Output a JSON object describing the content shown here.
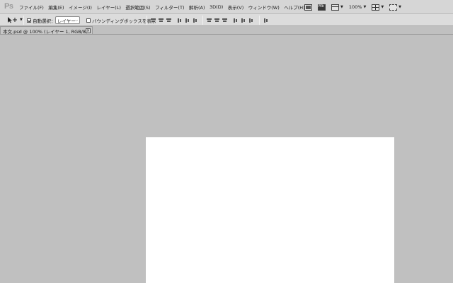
{
  "app": {
    "logo": "Ps"
  },
  "menubar": {
    "items": [
      "ファイル(F)",
      "編集(E)",
      "イメージ(I)",
      "レイヤー(L)",
      "選択範囲(S)",
      "フィルター(T)",
      "解析(A)",
      "3D(D)",
      "表示(V)",
      "ウィンドウ(W)",
      "ヘルプ(H)"
    ],
    "zoom": "100%"
  },
  "options": {
    "auto_select_label": "自動選択：",
    "auto_select_checked": true,
    "layer_select_value": "レイヤー",
    "bounding_box_label": "バウンディングボックスを表示",
    "bounding_box_checked": false
  },
  "document": {
    "tab_title": "本文.psd @ 100% (レイヤー 1, RGB/8)",
    "close_glyph": "×",
    "canvas_color": "#ffffff",
    "workspace_color": "#c0c0c0"
  }
}
